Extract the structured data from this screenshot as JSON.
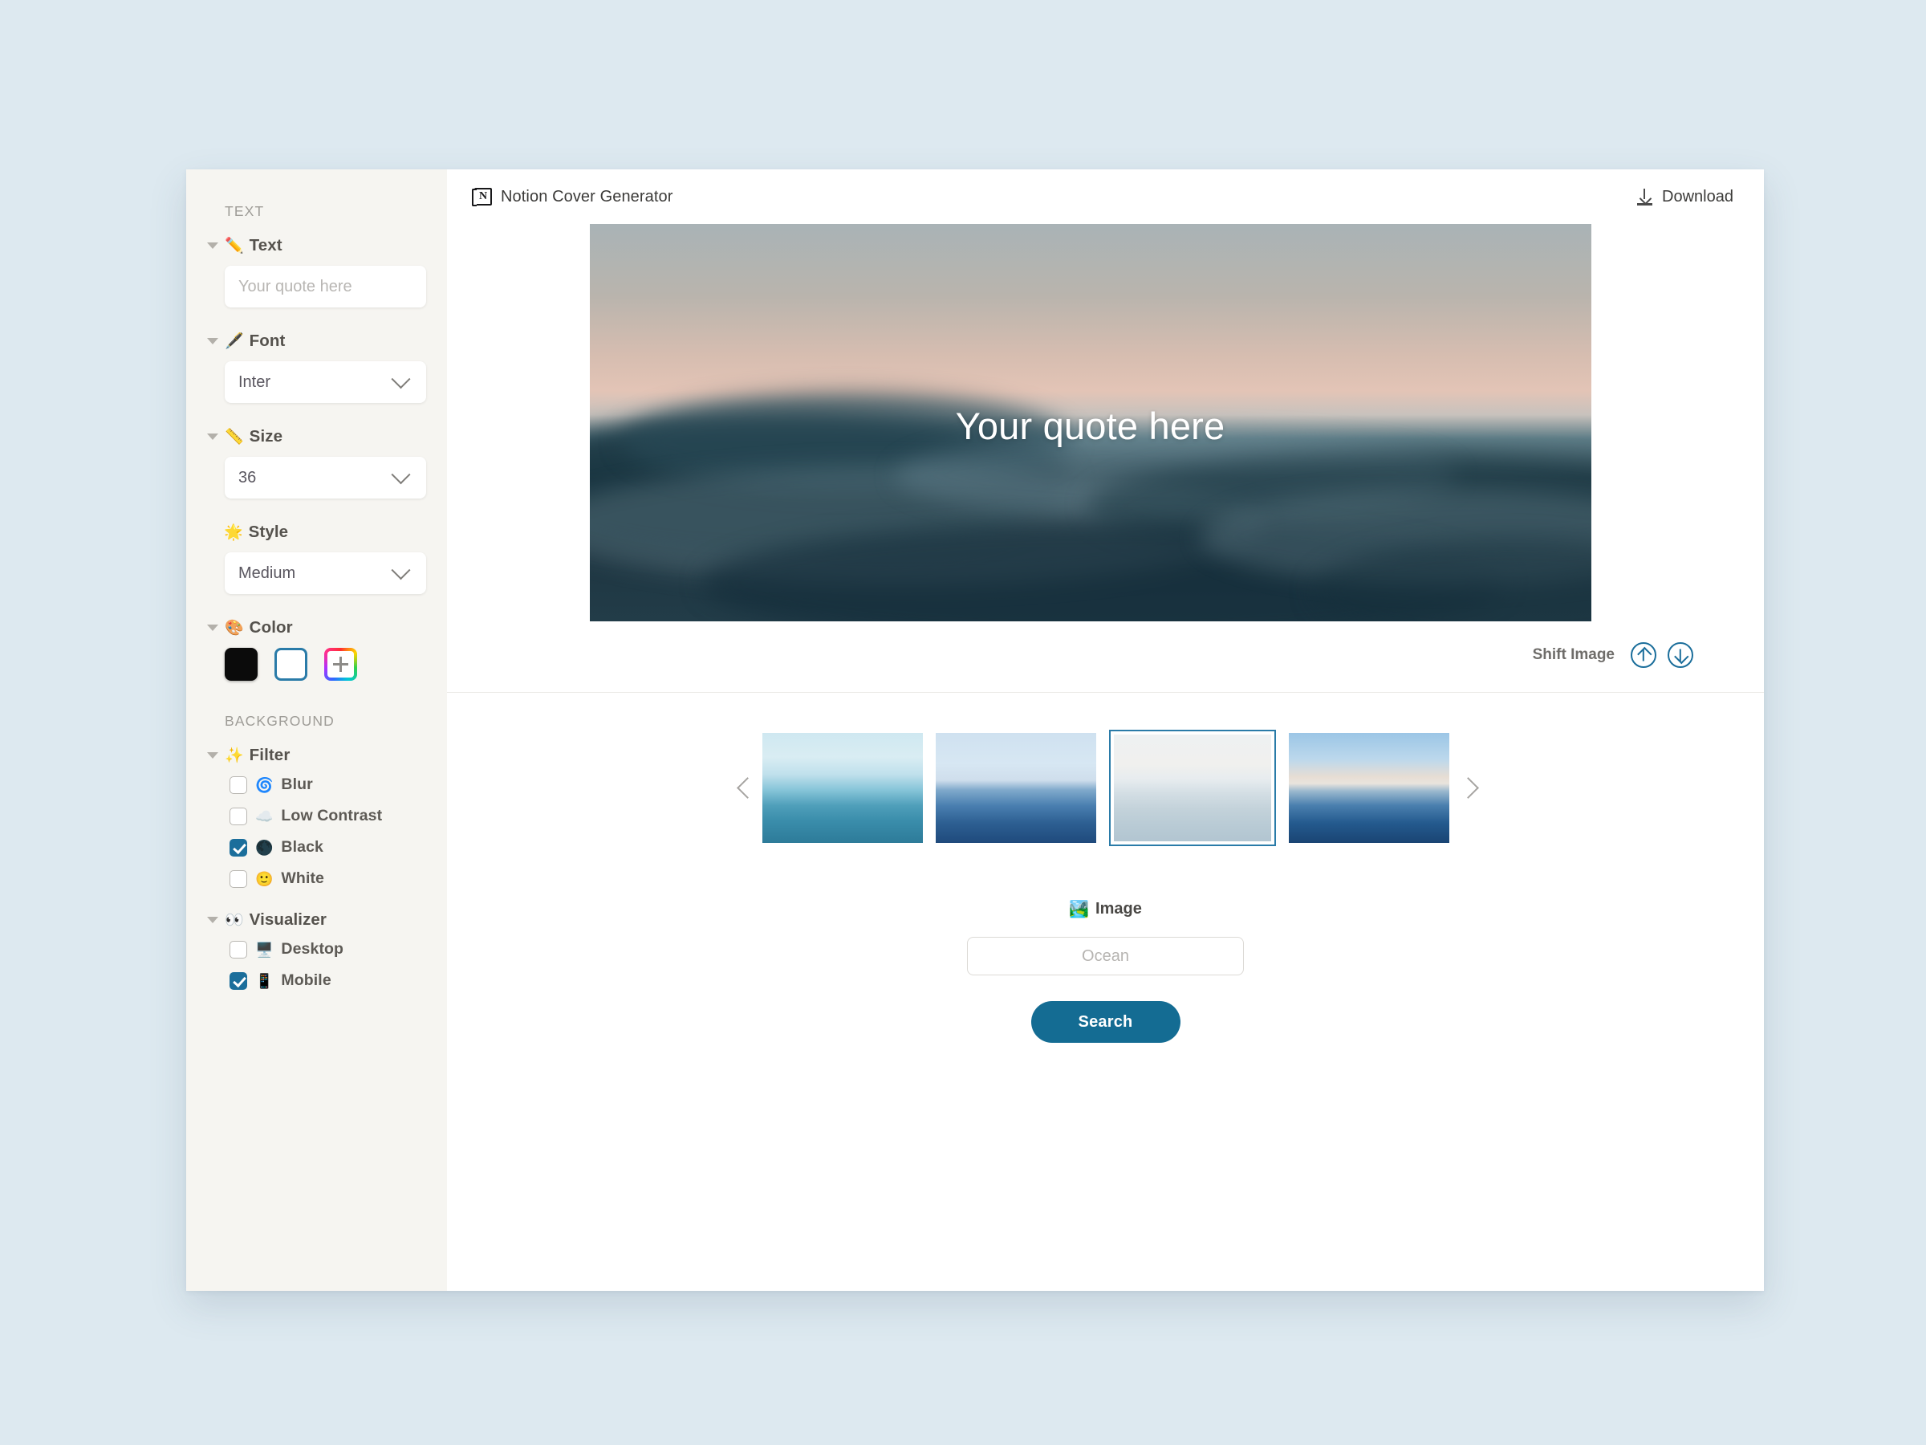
{
  "page": {
    "background_color": "#dde9f0"
  },
  "header": {
    "logo_icon": "notion-logo-icon",
    "title": "Notion Cover Generator",
    "download": {
      "label": "Download",
      "icon": "download-icon"
    }
  },
  "sidebar": {
    "sections": [
      {
        "caption": "TEXT",
        "groups": [
          {
            "key": "text",
            "emoji": "✏️",
            "label": "Text",
            "collapsible": true,
            "control": {
              "type": "input",
              "value": "",
              "placeholder": "Your quote here"
            }
          },
          {
            "key": "font",
            "emoji": "🖋️",
            "label": "Font",
            "collapsible": true,
            "control": {
              "type": "select",
              "value": "Inter"
            }
          },
          {
            "key": "size",
            "emoji": "📏",
            "label": "Size",
            "collapsible": true,
            "control": {
              "type": "select",
              "value": "36"
            }
          },
          {
            "key": "style",
            "emoji": "🌟",
            "label": "Style",
            "collapsible": false,
            "control": {
              "type": "select",
              "value": "Medium"
            }
          },
          {
            "key": "color",
            "emoji": "🎨",
            "label": "Color",
            "collapsible": true,
            "control": {
              "type": "swatches"
            }
          }
        ]
      },
      {
        "caption": "BACKGROUND",
        "groups": [
          {
            "key": "filter",
            "emoji": "✨",
            "label": "Filter",
            "collapsible": true,
            "control": {
              "type": "checkboxes"
            }
          },
          {
            "key": "visualizer",
            "emoji": "👀",
            "label": "Visualizer",
            "collapsible": true,
            "control": {
              "type": "checkboxes"
            }
          }
        ]
      }
    ],
    "color_swatches": [
      {
        "name": "black-swatch",
        "hex": "#0b0b0b",
        "selected": false
      },
      {
        "name": "white-swatch",
        "hex": "#ffffff",
        "selected": true
      },
      {
        "name": "add-color-swatch",
        "hex": "rainbow",
        "selected": false,
        "glyph": "+"
      }
    ],
    "filter_options": [
      {
        "emoji": "🌀",
        "label": "Blur",
        "checked": false
      },
      {
        "emoji": "☁️",
        "label": "Low Contrast",
        "checked": false
      },
      {
        "emoji": "🌑",
        "label": "Black",
        "checked": true
      },
      {
        "emoji": "🙂",
        "label": "White",
        "checked": false
      }
    ],
    "visualizer_options": [
      {
        "emoji": "🖥️",
        "label": "Desktop",
        "checked": false
      },
      {
        "emoji": "📱",
        "label": "Mobile",
        "checked": true
      }
    ]
  },
  "preview": {
    "quote_text": "Your quote here",
    "quote_color": "#ffffff",
    "shift": {
      "label": "Shift Image",
      "up_icon": "arrow-up-circle-icon",
      "down_icon": "arrow-down-circle-icon",
      "accent_color": "#1b6e9b"
    }
  },
  "carousel": {
    "prev_icon": "chevron-left-icon",
    "next_icon": "chevron-right-icon",
    "selected_index": 2,
    "selection_color": "#2a7ba8",
    "thumbnails": [
      {
        "name": "thumbnail-turquoise-surf",
        "alt": "Turquoise ocean waves with surfer"
      },
      {
        "name": "thumbnail-calm-blue-sea",
        "alt": "Calm blue sea with pale sky"
      },
      {
        "name": "thumbnail-pale-wave",
        "alt": "Pale washed-out ocean wave"
      },
      {
        "name": "thumbnail-deep-blue-sea",
        "alt": "Deep blue choppy ocean at dusk"
      }
    ]
  },
  "search": {
    "label_emoji": "🏞️",
    "label": "Image",
    "input_value": "",
    "input_placeholder": "Ocean",
    "button_label": "Search",
    "button_color": "#146c93"
  }
}
